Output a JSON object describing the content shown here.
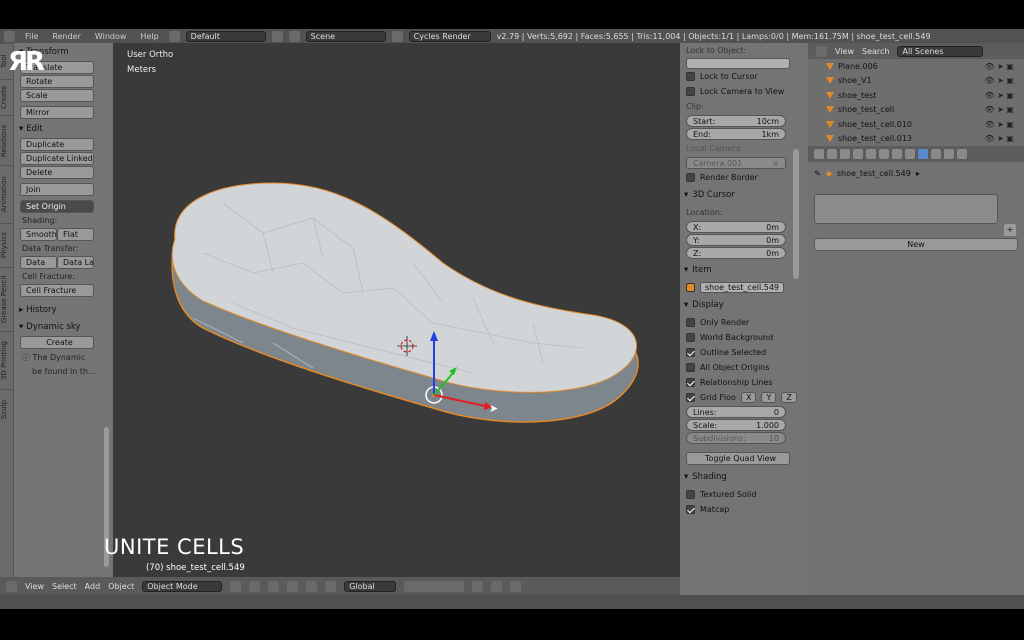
{
  "topbar": {
    "menus": [
      "File",
      "Render",
      "Window",
      "Help"
    ],
    "layout": "Default",
    "scene": "Scene",
    "engine": "Cycles Render",
    "stats": "v2.79 | Verts:5,692 | Faces:5,655 | Tris:11,004 | Objects:1/1 | Lamps:0/0 | Mem:161.75M | shoe_test_cell.549"
  },
  "tabs": [
    "Tool",
    "Create",
    "Relations",
    "Animation",
    "Physics",
    "Grease Pencil",
    "3D Printing",
    "Sculp"
  ],
  "toolshelf": {
    "transform_title": "Transform",
    "transform": [
      "Translate",
      "Rotate",
      "Scale",
      "Mirror"
    ],
    "edit_title": "Edit",
    "edit": [
      "Duplicate",
      "Duplicate Linked",
      "Delete",
      "Join"
    ],
    "set_origin": "Set Origin",
    "shading_label": "Shading:",
    "smooth": "Smooth",
    "flat": "Flat",
    "data_transfer_label": "Data Transfer:",
    "data": "Data",
    "data_la": "Data La",
    "cell_fracture_label": "Cell Fracture:",
    "cell_fracture": "Cell Fracture",
    "history_title": "History",
    "dynamic_title": "Dynamic sky",
    "create": "Create",
    "info1": "The Dynamic",
    "info2": "be found in th..."
  },
  "viewport": {
    "view_name": "User Ortho",
    "units": "Meters",
    "overlay_title": "UNITE CELLS",
    "object_label": "(70) shoe_test_cell.549"
  },
  "header3d": {
    "menus": [
      "View",
      "Select",
      "Add",
      "Object"
    ],
    "mode": "Object Mode",
    "orientation": "Global"
  },
  "props": {
    "lock_to_object": "Lock to Object:",
    "lock_to_cursor": "Lock to Cursor",
    "lock_camera": "Lock Camera to View",
    "clip_label": "Clip:",
    "start_label": "Start:",
    "start_value": "10cm",
    "end_label": "End:",
    "end_value": "1km",
    "local_camera": "Local Camera:",
    "camera": "Camera.001",
    "render_border": "Render Border",
    "cursor_title": "3D Cursor",
    "location_label": "Location:",
    "x_label": "X:",
    "x_value": "0m",
    "y_label": "Y:",
    "y_value": "0m",
    "z_label": "Z:",
    "z_value": "0m",
    "item_title": "Item",
    "item_name": "shoe_test_cell.549",
    "display_title": "Display",
    "only_render": "Only Render",
    "world_background": "World Background",
    "outline_selected": "Outline Selected",
    "all_origins": "All Object Origins",
    "relationship_lines": "Relationship Lines",
    "grid_floor": "Grid Floo",
    "gx": "X",
    "gy": "Y",
    "gz": "Z",
    "lines_label": "Lines:",
    "lines_value": "0",
    "scale_label": "Scale:",
    "scale_value": "1.000",
    "subdiv_label": "Subdivisions:",
    "subdiv_value": "10",
    "toggle_quad": "Toggle Quad View",
    "shading_title": "Shading",
    "textured_solid": "Textured Solid",
    "matcap": "Matcap"
  },
  "outliner": {
    "view": "View",
    "search": "Search",
    "scenes": "All Scenes",
    "rows": [
      "Plane.006",
      "shoe_V1",
      "shoe_test",
      "shoe_test_cell",
      "shoe_test_cell.010",
      "shoe_test_cell.013"
    ]
  },
  "properties": {
    "breadcrumb": "shoe_test_cell.549",
    "new_button": "New"
  },
  "colors": {
    "accent_orange": "#e08a2a",
    "viewport_bg": "#3a3a3a",
    "panel_bg": "#747474"
  }
}
